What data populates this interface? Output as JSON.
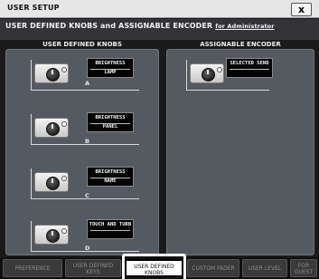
{
  "window": {
    "title": "USER SETUP",
    "close_label": "x"
  },
  "subheader": {
    "title": "USER DEFINED KNOBS and ASSIGNABLE ENCODER",
    "for_label": "for Administrator"
  },
  "knobs_section": {
    "heading": "USER DEFINED KNOBS",
    "rows": [
      {
        "line1": "BRIGHTNESS",
        "line2": "LAMP",
        "letter": "A"
      },
      {
        "line1": "BRIGHTNESS",
        "line2": "PANEL",
        "letter": "B"
      },
      {
        "line1": "BRIGHTNESS",
        "line2": "NAME",
        "letter": "C"
      },
      {
        "line1": "TOUCH AND TURN",
        "line2": "",
        "letter": "D"
      }
    ]
  },
  "encoder_section": {
    "heading": "ASSIGNABLE ENCODER",
    "param": {
      "line1": "SELECTED SEND",
      "line2": ""
    }
  },
  "tabs": [
    {
      "line1": "PREFERENCE",
      "line2": ""
    },
    {
      "line1": "USER DEFINED",
      "line2": "KEYS"
    },
    {
      "line1": "USER DEFINED",
      "line2": "KNOBS"
    },
    {
      "line1": "CUSTOM FADER",
      "line2": ""
    },
    {
      "line1": "USER LEVEL",
      "line2": ""
    },
    {
      "line1": "FOR",
      "line2": "GUEST"
    }
  ],
  "active_tab": "USER DEFINED KNOBS"
}
